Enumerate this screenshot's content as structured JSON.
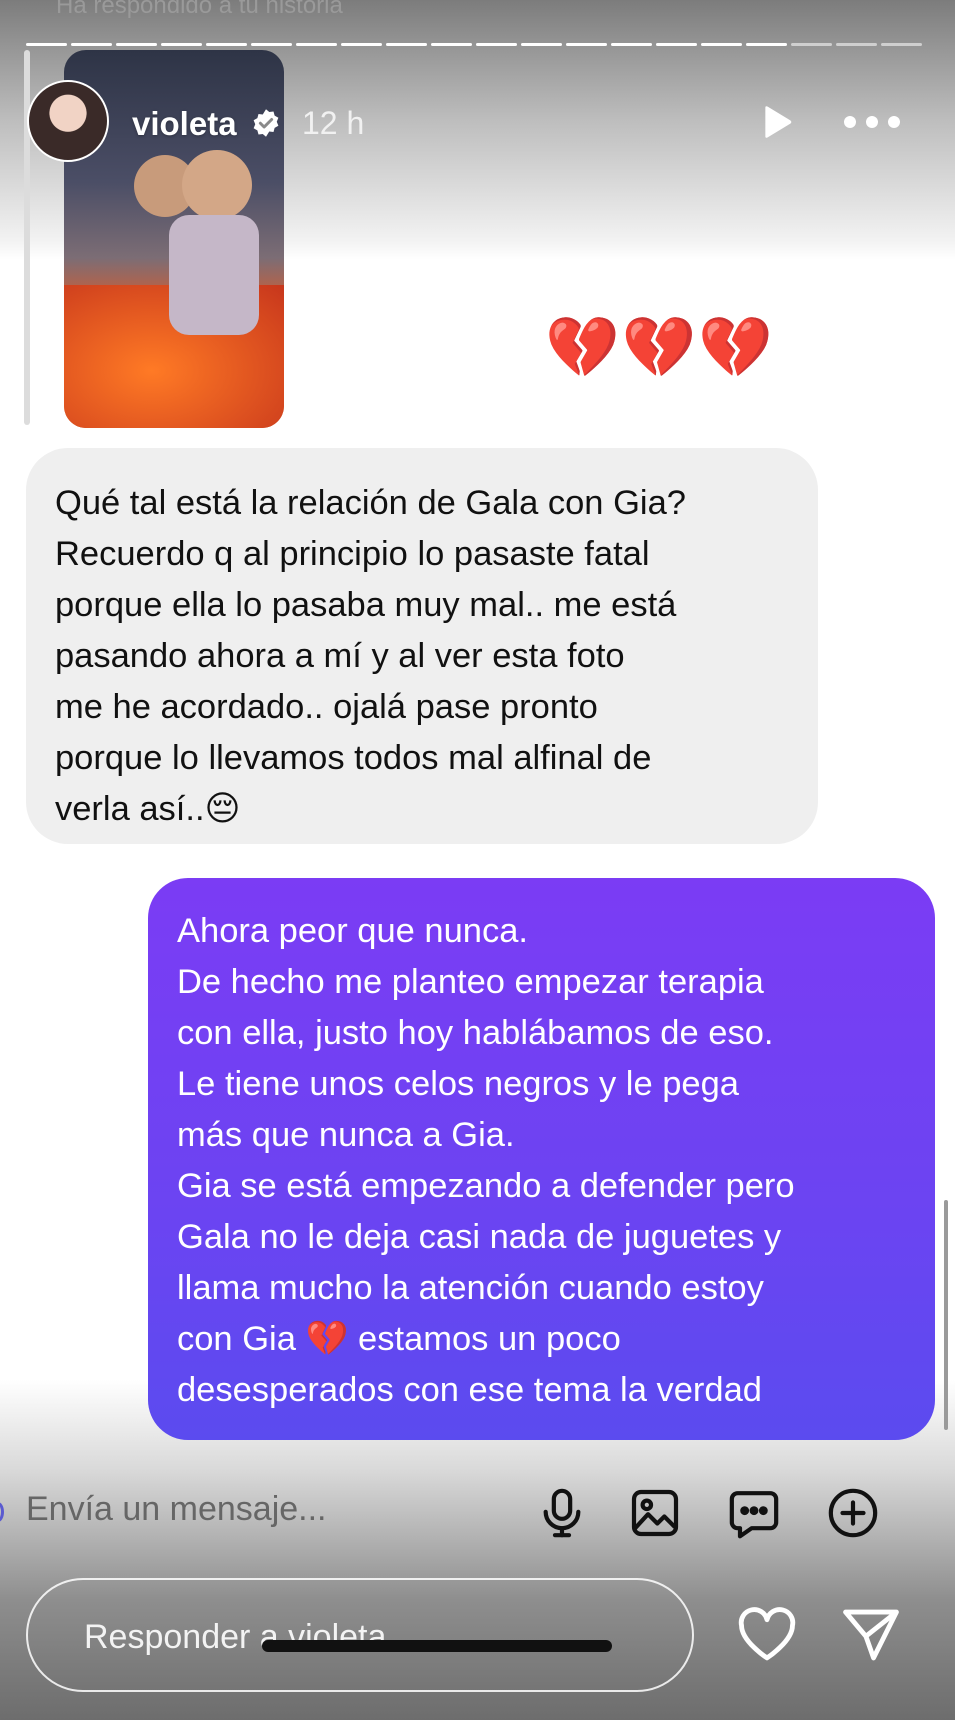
{
  "story": {
    "reply_hint": "Ha respondido a tu historia",
    "username": "violeta",
    "time": "12 h",
    "reaction": "💔💔💔"
  },
  "messages": {
    "incoming": {
      "lines": [
        "Qué tal está la relación de Gala con Gia?",
        "Recuerdo q al principio lo pasaste fatal",
        "porque ella lo pasaba muy mal.. me está",
        "pasando ahora a mí y al ver esta foto",
        "me he acordado.. ojalá pase pronto",
        "porque lo llevamos todos mal alfinal de",
        "verla así..😔"
      ]
    },
    "outgoing": {
      "lines": [
        "Ahora peor que nunca.",
        "De hecho me planteo empezar terapia",
        "con ella, justo hoy hablábamos de eso.",
        "Le tiene unos celos negros y le pega",
        "más que nunca a Gia.",
        "Gia se está empezando a defender pero",
        "Gala no le deja casi nada de juguetes y",
        "llama mucho la atención cuando estoy",
        "con Gia 💔 estamos un poco",
        "desesperados con ese tema la verdad"
      ]
    }
  },
  "composer": {
    "placeholder": "Envía un mensaje..."
  },
  "reply": {
    "placeholder": "Responder a violeta..."
  },
  "colors": {
    "outgoing_bubble": "#6b44f2",
    "incoming_bubble": "#efefef"
  }
}
